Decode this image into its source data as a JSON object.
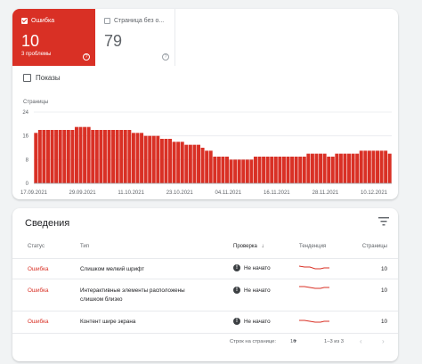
{
  "metrics": {
    "errors": {
      "label": "Ошибка",
      "value": "10",
      "sub": "3 проблемы",
      "help": "?"
    },
    "pages": {
      "label": "Страница без о...",
      "value": "79",
      "help": "?"
    }
  },
  "impressions_label": "Показы",
  "chart_data": {
    "type": "bar",
    "ylabel": "Страницы",
    "ylim": [
      0,
      24
    ],
    "yticks": [
      "24",
      "16",
      "8",
      "0"
    ],
    "xticks": [
      "17.09.2021",
      "29.09.2021",
      "11.10.2021",
      "23.10.2021",
      "04.11.2021",
      "16.11.2021",
      "28.11.2021",
      "10.12.2021"
    ],
    "values": [
      17,
      18,
      18,
      18,
      18,
      18,
      18,
      18,
      18,
      18,
      19,
      19,
      19,
      19,
      18,
      18,
      18,
      18,
      18,
      18,
      18,
      18,
      18,
      18,
      17,
      17,
      17,
      16,
      16,
      16,
      16,
      15,
      15,
      15,
      14,
      14,
      14,
      13,
      13,
      13,
      13,
      12,
      11,
      11,
      9,
      9,
      9,
      9,
      8,
      8,
      8,
      8,
      8,
      8,
      9,
      9,
      9,
      9,
      9,
      9,
      9,
      9,
      9,
      9,
      9,
      9,
      9,
      10,
      10,
      10,
      10,
      10,
      9,
      9,
      10,
      10,
      10,
      10,
      10,
      10,
      11,
      11,
      11,
      11,
      11,
      11,
      11,
      10
    ],
    "color": "#d93025"
  },
  "details": {
    "title": "Сведения",
    "headers": {
      "status": "Статус",
      "type": "Тип",
      "check": "Проверка",
      "trend": "Тенденция",
      "pages": "Страницы"
    },
    "sort_arrow": "↓",
    "rows": [
      {
        "status": "Ошибка",
        "type": "Слишком мелкий шрифт",
        "type2": "",
        "check": "Не начато",
        "pages": "10"
      },
      {
        "status": "Ошибка",
        "type": "Интерактивные элементы расположены",
        "type2": "слишком близко",
        "check": "Не начато",
        "pages": "10"
      },
      {
        "status": "Ошибка",
        "type": "Контент шире экрана",
        "type2": "",
        "check": "Не начато",
        "pages": "10"
      }
    ]
  },
  "pagination": {
    "rows_label": "Строк на странице:",
    "rows_value": "10",
    "range": "1–3 из 3"
  },
  "colors": {
    "error": "#d93025",
    "text": "#202124",
    "muted": "#5f6368"
  }
}
